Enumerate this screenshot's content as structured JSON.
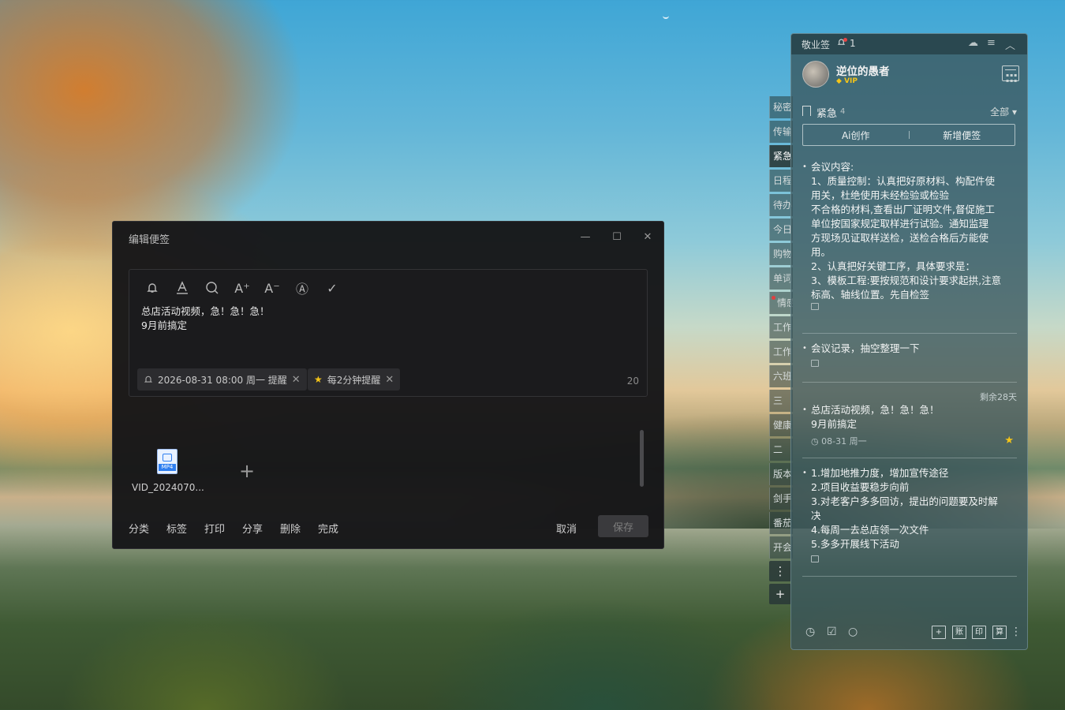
{
  "edit_dialog": {
    "title": "编辑便签",
    "win_minimize": "—",
    "win_maximize": "☐",
    "win_close": "✕",
    "toolbar": {
      "bell": "🔔",
      "font_color": "A",
      "search": "○",
      "font_up": "A⁺",
      "font_down": "A⁻",
      "text_style": "Ⓐ",
      "done": "✓"
    },
    "content_line1": "总店活动视频，急！急！急！",
    "content_line2": "9月前搞定",
    "reminder_chip": "2026-08-31 08:00 周一 提醒",
    "repeat_chip": "每2分钟提醒",
    "char_count": "20",
    "attachment": {
      "type_label": "MP4",
      "file_name": "VID_2024070..."
    },
    "add_attachment": "+",
    "footer": {
      "category": "分类",
      "tags": "标签",
      "print": "打印",
      "share": "分享",
      "delete": "删除",
      "complete": "完成",
      "cancel": "取消",
      "save": "保存"
    }
  },
  "side_tabs": [
    {
      "label": "秘密",
      "active": false
    },
    {
      "label": "传输",
      "active": false
    },
    {
      "label": "紧急",
      "active": true
    },
    {
      "label": "日程",
      "active": false
    },
    {
      "label": "待办",
      "active": false
    },
    {
      "label": "今日",
      "active": false
    },
    {
      "label": "购物",
      "active": false
    },
    {
      "label": "单词",
      "active": false
    },
    {
      "label": "情感",
      "active": false
    },
    {
      "label": "工作",
      "active": false
    },
    {
      "label": "工作",
      "active": false
    },
    {
      "label": "六班",
      "active": false
    },
    {
      "label": "三",
      "active": false
    },
    {
      "label": "健康",
      "active": false
    },
    {
      "label": "二",
      "active": false
    },
    {
      "label": "版本",
      "active": false
    },
    {
      "label": "剑手",
      "active": false
    },
    {
      "label": "番茄",
      "active": false
    },
    {
      "label": "开会",
      "active": false
    }
  ],
  "side_more": "⋮",
  "side_add": "+",
  "panel": {
    "app_name": "敬业签",
    "bell_count": "1",
    "user": {
      "name": "逆位的愚者",
      "badge": "VIP"
    },
    "category": {
      "name": "紧急",
      "count": "4",
      "filter": "全部 ▾"
    },
    "ai_button": "Ai创作",
    "new_button": "新增便签",
    "notes": [
      {
        "lines": [
          "会议内容:",
          "1、质量控制：认真把好原材料、构配件使",
          "用关，杜绝使用未经检验或检验",
          "不合格的材料,查看出厂证明文件,督促施工",
          "单位按国家规定取样进行试验。通知监理",
          "方现场见证取样送检，送检合格后方能使",
          "用。",
          "2、认真把好关键工序，具体要求是：",
          "3、模板工程:要按规范和设计要求起拱,注意",
          "标高、轴线位置。先自检签"
        ]
      },
      {
        "lines": [
          "会议记录，抽空整理一下"
        ]
      },
      {
        "remaining": "剩余28天",
        "lines": [
          "总店活动视频，急！急！急！",
          "9月前搞定"
        ],
        "meta": "08-31 周一",
        "starred": true
      },
      {
        "lines": [
          "1.增加地推力度，增加宣传途径",
          "2.项目收益要稳步向前",
          "3.对老客户多多回访，提出的问题要及时解",
          "决",
          "4.每周一去总店领一次文件",
          "5.多多开展线下活动"
        ]
      }
    ],
    "footer": {
      "box1": "+",
      "box2": "账",
      "box3": "印",
      "box4": "算"
    }
  }
}
